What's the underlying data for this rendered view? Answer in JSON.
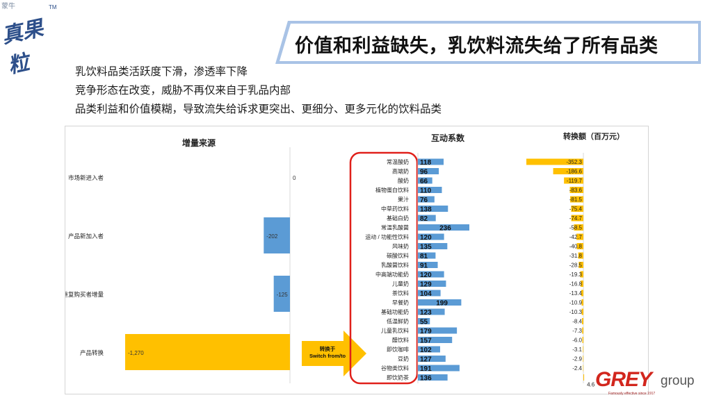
{
  "brand": {
    "small_text": "蒙牛",
    "logo_text": "真果粒",
    "tm": "TM"
  },
  "title": "价值和利益缺失，乳饮料流失给了所有品类",
  "bullets": [
    "乳饮料品类活跃度下滑，渗透率下降",
    "竞争形态在改变，威胁不再仅来自于乳品内部",
    "品类利益和价值模糊，导致流失给诉求更突出、更细分、更多元化的饮料品类"
  ],
  "colors": {
    "banner": "#a9c3e6",
    "blue_bar": "#5b9bd5",
    "yellow_bar": "#ffc000",
    "red_outline": "#e0201a"
  },
  "arrow_label": [
    "转换于",
    "Switch from/to"
  ],
  "chart_data": [
    {
      "type": "bar",
      "title": "增量来源",
      "orientation": "horizontal",
      "categories": [
        "市场新进入者",
        "产品新加入者",
        "重复购买者增量",
        "产品转换"
      ],
      "values": [
        0,
        -202,
        -125,
        -1270
      ],
      "value_labels": [
        "0",
        "-202",
        "-125",
        "-1,270"
      ],
      "colors": [
        "#5b9bd5",
        "#5b9bd5",
        "#5b9bd5",
        "#ffc000"
      ]
    },
    {
      "type": "bar",
      "title": "互动系数",
      "orientation": "horizontal",
      "categories": [
        "常温酸奶",
        "高端奶",
        "酸奶",
        "植物蛋白饮料",
        "果汁",
        "中草药饮料",
        "基础白奶",
        "常温乳酸菌",
        "运动 / 功能性饮料",
        "风味奶",
        "碳酸饮料",
        "乳酸菌饮料",
        "中高端功能奶",
        "儿童奶",
        "茶饮料",
        "早餐奶",
        "基础功能奶",
        "低温鲜奶",
        "儿童乳饮料",
        "醋饮料",
        "即饮咖啡",
        "豆奶",
        "谷物类饮料",
        "即饮奶茶"
      ],
      "values": [
        118,
        96,
        66,
        110,
        76,
        138,
        82,
        236,
        120,
        135,
        81,
        91,
        120,
        129,
        104,
        199,
        123,
        55,
        179,
        157,
        102,
        127,
        191,
        136
      ]
    },
    {
      "type": "bar",
      "title": "转换额（百万元）",
      "orientation": "horizontal",
      "categories": [
        "常温酸奶",
        "高端奶",
        "酸奶",
        "植物蛋白饮料",
        "果汁",
        "中草药饮料",
        "基础白奶",
        "常温乳酸菌",
        "运动 / 功能性饮料",
        "风味奶",
        "碳酸饮料",
        "乳酸菌饮料",
        "中高端功能奶",
        "儿童奶",
        "茶饮料",
        "早餐奶",
        "基础功能奶",
        "低温鲜奶",
        "儿童乳饮料",
        "醋饮料",
        "即饮咖啡",
        "豆奶",
        "谷物类饮料",
        "即饮奶茶"
      ],
      "values": [
        -352.3,
        -186.6,
        -119.7,
        -83.6,
        -81.5,
        -75.4,
        -74.7,
        -58.5,
        -42.7,
        -40.8,
        -31.8,
        -28.5,
        -19.3,
        -16.8,
        -13.4,
        -10.9,
        -10.3,
        -8.4,
        -7.3,
        -6.0,
        -3.1,
        -2.9,
        -2.4,
        4.6
      ],
      "value_labels": [
        "-352.3",
        "-186.6",
        "-119.7",
        "-83.6",
        "-81.5",
        "-75.4",
        "-74.7",
        "-58.5",
        "-42.7",
        "-40.8",
        "-31.8",
        "-28.5",
        "-19.3",
        "-16.8",
        "-13.4",
        "-10.9",
        "-10.3",
        "-8.4",
        "-7.3",
        "-6.0",
        "-3.1",
        "-2.9",
        "-2.4",
        "4.6"
      ]
    }
  ],
  "footer_logo": {
    "word": "GREY",
    "group": "group",
    "tagline": "Famously effective since 1917"
  }
}
